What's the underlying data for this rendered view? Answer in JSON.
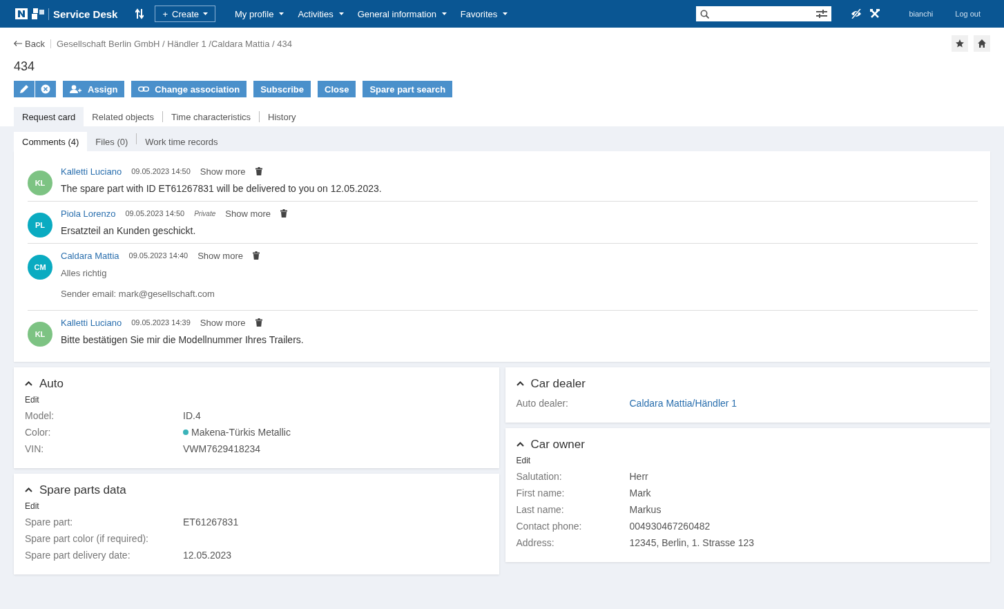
{
  "topbar": {
    "app_name": "Service Desk",
    "create": {
      "icon": "+",
      "label": "Create"
    },
    "menus": [
      "My profile",
      "Activities",
      "General information",
      "Favorites"
    ],
    "user": "bianchi",
    "logout": "Log out"
  },
  "breadcrumb": {
    "back": "Back",
    "path": "Gesellschaft Berlin GmbH / Händler 1 /Caldara Mattia / 434"
  },
  "title": "434",
  "actions": [
    {
      "kind": "edit"
    },
    {
      "kind": "cancel"
    },
    {
      "kind": "assign",
      "label": "Assign"
    },
    {
      "kind": "link",
      "label": "Change association"
    },
    {
      "kind": "plain",
      "label": "Subscribe"
    },
    {
      "kind": "plain",
      "label": "Close"
    },
    {
      "kind": "plain",
      "label": "Spare part search"
    }
  ],
  "tabs": [
    {
      "label": "Request card",
      "selected": true
    },
    {
      "label": "Related objects",
      "selected": false
    },
    {
      "label": "Time characteristics",
      "selected": false
    },
    {
      "label": "History",
      "selected": false
    }
  ],
  "subtabs": [
    {
      "label": "Comments (4)",
      "selected": true
    },
    {
      "label": "Files (0)",
      "selected": false
    },
    {
      "label": "Work time records",
      "selected": false
    }
  ],
  "comments": [
    {
      "initials": "KL",
      "color": "#7dc383",
      "author": "Kalletti Luciano",
      "time": "09.05.2023 14:50",
      "show_more": "Show more",
      "kind": "text",
      "body": [
        "The spare part with ID ET61267831 will be delivered to you on 12.05.2023."
      ]
    },
    {
      "initials": "PL",
      "color": "#0aabc1",
      "author": "Piola Lorenzo",
      "time": "09.05.2023 14:50",
      "tag": "Private",
      "show_more": "Show more",
      "kind": "text",
      "body": [
        "Ersatzteil an Kunden geschickt."
      ]
    },
    {
      "initials": "CM",
      "color": "#0aabc1",
      "author": "Caldara Mattia",
      "time": "09.05.2023 14:40",
      "show_more": "Show more",
      "kind": "email",
      "body": [
        "Alles richtig",
        "Sender email: mark@gesellschaft.com"
      ]
    },
    {
      "initials": "KL",
      "color": "#7dc383",
      "author": "Kalletti Luciano",
      "time": "09.05.2023 14:39",
      "show_more": "Show more",
      "kind": "text",
      "body": [
        "Bitte bestätigen Sie mir die Modellnummer Ihres Trailers."
      ]
    }
  ],
  "left_cards": [
    {
      "title": "Auto",
      "expanded": true,
      "edit": "Edit",
      "fields": [
        {
          "label": "Model:",
          "value": "ID.4"
        },
        {
          "label": "Color:",
          "value": "Makena-Türkis Metallic",
          "color": "#3bb3b9"
        },
        {
          "label": "VIN:",
          "value": "VWM7629418234"
        }
      ]
    },
    {
      "title": "Spare parts data",
      "expanded": true,
      "edit": "Edit",
      "fields": [
        {
          "label": "Spare part:",
          "value": "ET61267831"
        },
        {
          "label": "Spare part color (if required):"
        },
        {
          "label": "Spare part delivery date:",
          "value": "12.05.2023"
        }
      ]
    }
  ],
  "right_cards": [
    {
      "title": "Car dealer",
      "expanded": true,
      "fields": [
        {
          "label": "Auto dealer:",
          "value": "Caldara Mattia/Händler 1",
          "kind": "link"
        }
      ]
    },
    {
      "title": "Car owner",
      "expanded": true,
      "edit": "Edit",
      "fields": [
        {
          "label": "Salutation:",
          "value": "Herr"
        },
        {
          "label": "First name:",
          "value": "Mark"
        },
        {
          "label": "Last name:",
          "value": "Markus"
        },
        {
          "label": "Contact phone:",
          "value": "004930467260482"
        },
        {
          "label": "Address:",
          "value": "12345, Berlin, 1. Strasse 123"
        }
      ]
    }
  ]
}
